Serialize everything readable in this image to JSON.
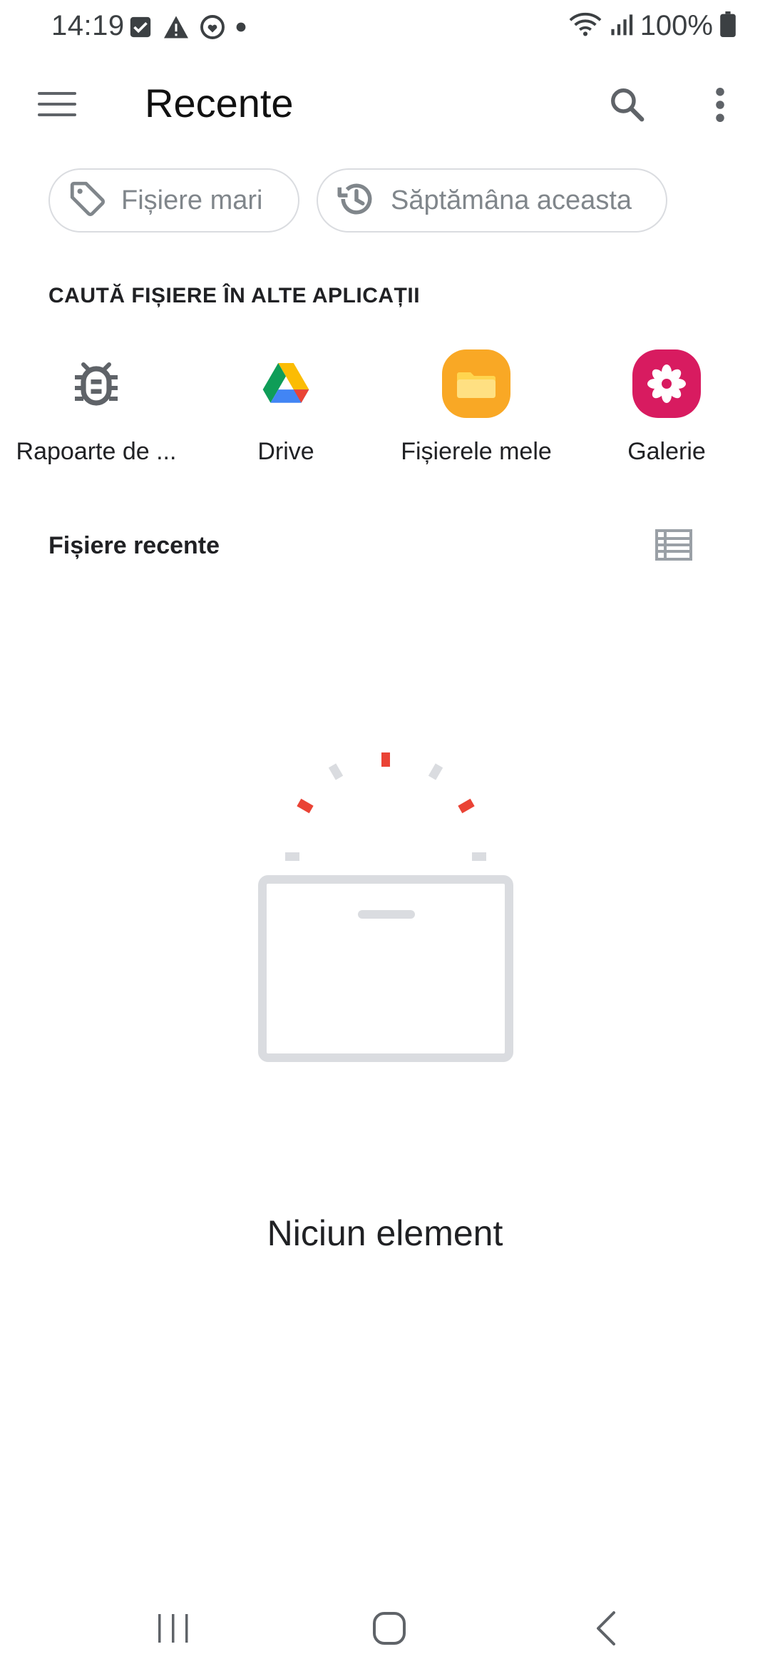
{
  "status_bar": {
    "time": "14:19",
    "battery": "100%",
    "icons_left": [
      "checkbox-notification-icon",
      "warning-icon",
      "heart-circle-icon",
      "dot-icon"
    ],
    "icons_right": [
      "wifi-icon",
      "signal-icon",
      "battery-icon"
    ]
  },
  "app_bar": {
    "title": "Recente",
    "menu_icon": "hamburger-menu-icon",
    "search_icon": "search-icon",
    "more_icon": "more-vert-icon"
  },
  "chips": [
    {
      "label": "Fișiere mari",
      "icon": "tag-icon"
    },
    {
      "label": "Săptămâna aceasta",
      "icon": "history-icon"
    }
  ],
  "other_apps": {
    "header": "CAUTĂ FIȘIERE ÎN ALTE APLICAȚII",
    "items": [
      {
        "label": "Rapoarte de ...",
        "icon": "bug-icon"
      },
      {
        "label": "Drive",
        "icon": "google-drive-icon"
      },
      {
        "label": "Fișierele mele",
        "icon": "folder-icon"
      },
      {
        "label": "Galerie",
        "icon": "gallery-flower-icon"
      }
    ]
  },
  "recent_files": {
    "title": "Fișiere recente",
    "view_icon": "list-view-icon",
    "empty_text": "Niciun element"
  },
  "colors": {
    "accent_red": "#ea4335",
    "gray_illustration": "#dadce0",
    "folder_orange": "#f9a825",
    "gallery_pink": "#d81b60"
  },
  "nav_bar": {
    "recents_icon": "recent-apps-icon",
    "home_icon": "home-icon",
    "back_icon": "back-icon"
  }
}
